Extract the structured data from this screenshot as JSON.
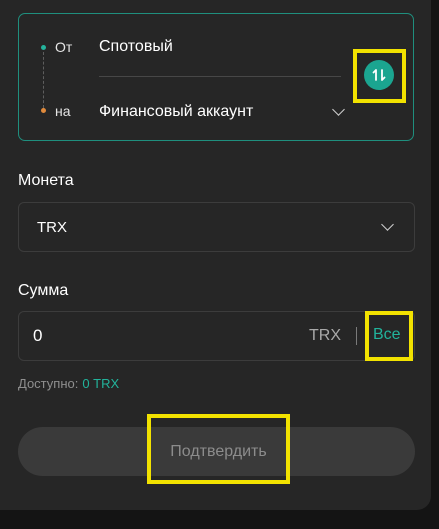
{
  "transfer": {
    "from_tag": "От",
    "from_account": "Спотовый",
    "to_tag": "на",
    "to_account": "Финансовый аккаунт",
    "swap_icon": "swap-vertical-arrows-icon"
  },
  "coin": {
    "label": "Монета",
    "value": "TRX",
    "dropdown_icon": "chevron-down-icon"
  },
  "amount": {
    "label": "Сумма",
    "value": "0",
    "unit": "TRX",
    "separator": "|",
    "all_label": "Все"
  },
  "available": {
    "label": "Доступно:",
    "value": "0 TRX"
  },
  "confirm": {
    "label": "Подтвердить"
  },
  "colors": {
    "accent": "#22b39b",
    "highlight": "#f2e200",
    "panel": "#262626",
    "from_dot": "#24b39c",
    "to_dot": "#e08a3c"
  }
}
